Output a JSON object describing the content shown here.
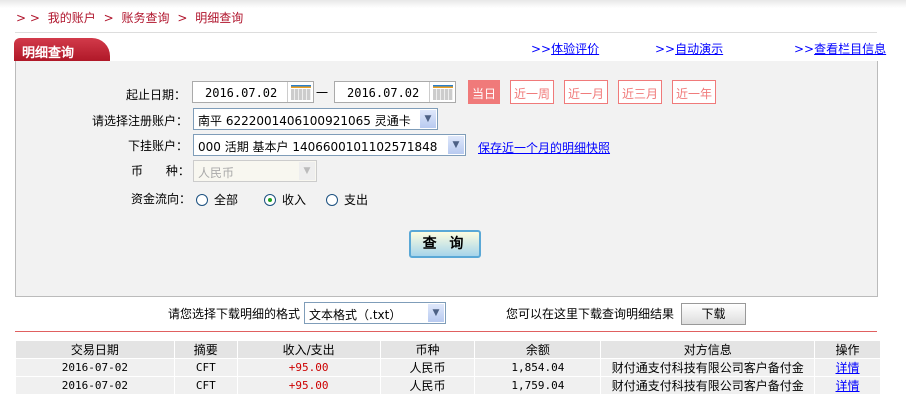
{
  "breadcrumb": {
    "prefix": "> >",
    "items": [
      "我的账户",
      "账务查询",
      "明细查询"
    ],
    "sep": ">"
  },
  "tab": {
    "title": "明细查询"
  },
  "top_links": [
    {
      "pre": ">>",
      "label": "体验评价"
    },
    {
      "pre": ">>",
      "label": "自动演示"
    },
    {
      "pre": ">>",
      "label": "查看栏目信息"
    }
  ],
  "form": {
    "date_label": "起止日期：",
    "start_date": "2016.07.02",
    "dash": "一",
    "end_date": "2016.07.02",
    "quick": [
      "当日",
      "近一周",
      "近一月",
      "近三月",
      "近一年"
    ],
    "quick_selected": "当日",
    "account_label": "请选择注册账户：",
    "account_value": "南平  6222001406100921065 灵通卡",
    "sub_label": "下挂账户：",
    "sub_value": "000 活期 基本户 1406600101102571848",
    "snapshot_link": "保存近一个月的明细快照",
    "currency_label": "币      种：",
    "currency_value": "人民币",
    "flow_label": "资金流向：",
    "flow_options": [
      "全部",
      "收入",
      "支出"
    ],
    "flow_selected": "收入",
    "query_button": "查 询"
  },
  "download": {
    "format_label": "请您选择下载明细的格式",
    "format_value": "文本格式（.txt）",
    "hint": "您可以在这里下载查询明细结果",
    "button": "下载"
  },
  "table": {
    "headers": [
      "交易日期",
      "摘要",
      "收入/支出",
      "币种",
      "余额",
      "对方信息",
      "操作"
    ],
    "rows": [
      [
        "2016-07-02",
        "CFT",
        "+95.00",
        "人民币",
        "1,854.04",
        "财付通支付科技有限公司客户备付金",
        "详情"
      ],
      [
        "2016-07-02",
        "CFT",
        "+95.00",
        "人民币",
        "1,759.04",
        "财付通支付科技有限公司客户备付金",
        "详情"
      ]
    ]
  },
  "colors": {
    "brand": "#b0142c",
    "accent_pink": "#f07a7a",
    "link": "#0000ff",
    "amount": "#cc0000"
  }
}
